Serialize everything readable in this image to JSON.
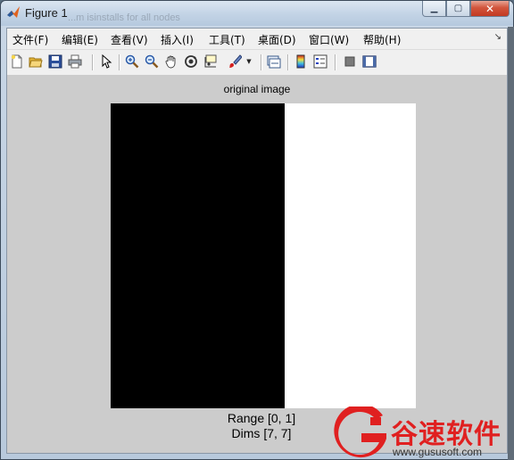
{
  "window": {
    "title": "Figure 1",
    "background_overlay_text": "...m isinstalls for all nodes",
    "buttons": [
      "minimize",
      "maximize",
      "close"
    ]
  },
  "menubar": {
    "items": [
      {
        "label": "文件(F)"
      },
      {
        "label": "编辑(E)"
      },
      {
        "label": "查看(V)"
      },
      {
        "label": "插入(I)"
      },
      {
        "label": "工具(T)"
      },
      {
        "label": "桌面(D)"
      },
      {
        "label": "窗口(W)"
      },
      {
        "label": "帮助(H)"
      }
    ],
    "overflow_arrow": "↘"
  },
  "toolbar": {
    "icons": [
      "new-figure-icon",
      "open-file-icon",
      "save-icon",
      "print-icon",
      "edit-plot-arrow-icon",
      "zoom-in-icon",
      "zoom-out-icon",
      "pan-hand-icon",
      "rotate-3d-icon",
      "data-cursor-icon",
      "brush-icon",
      "link-plot-icon",
      "colorbar-icon",
      "legend-icon",
      "hide-plot-tools-icon",
      "show-plot-tools-icon"
    ]
  },
  "figure": {
    "axes_title": "original image",
    "xlabel_line1": "Range [0, 1]",
    "xlabel_line2": "Dims [7, 7]",
    "image_colors": {
      "left": "#000000",
      "right": "#ffffff"
    },
    "background_color": "#cccccc"
  },
  "watermark": {
    "brand_cn": "谷速软件",
    "url": "www.gususoft.com",
    "color": "#e02020"
  }
}
